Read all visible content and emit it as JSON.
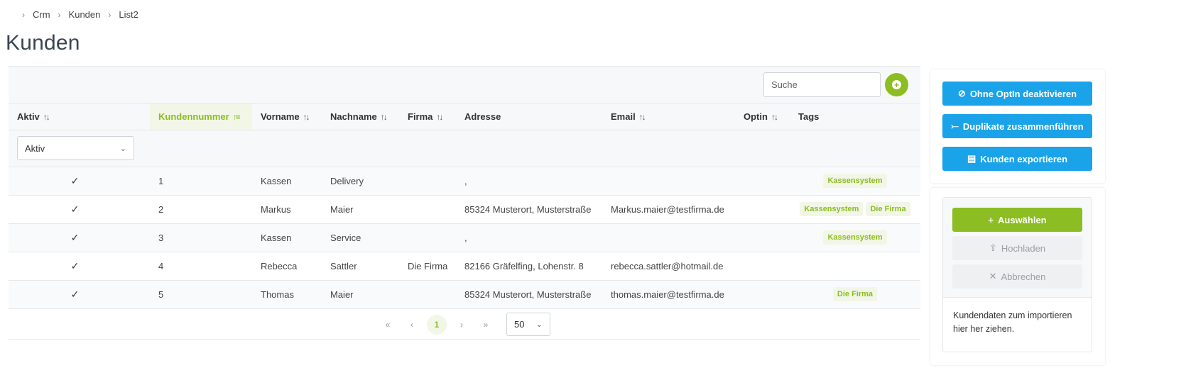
{
  "breadcrumb": [
    "Crm",
    "Kunden",
    "List2"
  ],
  "page": {
    "title": "Kunden"
  },
  "search": {
    "placeholder": "Suche"
  },
  "columns": [
    {
      "label": "Aktiv",
      "sortable": true
    },
    {
      "label": "Kundennummer",
      "sortable": true,
      "sorted": "asc"
    },
    {
      "label": "Vorname",
      "sortable": true
    },
    {
      "label": "Nachname",
      "sortable": true
    },
    {
      "label": "Firma",
      "sortable": true
    },
    {
      "label": "Adresse",
      "sortable": false
    },
    {
      "label": "Email",
      "sortable": true
    },
    {
      "label": "Optin",
      "sortable": true
    },
    {
      "label": "Tags",
      "sortable": false
    }
  ],
  "filter": {
    "aktiv_value": "Aktiv"
  },
  "rows": [
    {
      "aktiv": true,
      "kundennummer": "1",
      "vorname": "Kassen",
      "nachname": "Delivery",
      "firma": "",
      "adresse": ",",
      "email": "",
      "optin": "",
      "tags": [
        "Kassensystem"
      ]
    },
    {
      "aktiv": true,
      "kundennummer": "2",
      "vorname": "Markus",
      "nachname": "Maier",
      "firma": "",
      "adresse": "85324 Musterort, Musterstraße",
      "email": "Markus.maier@testfirma.de",
      "optin": "",
      "tags": [
        "Kassensystem",
        "Die Firma"
      ]
    },
    {
      "aktiv": true,
      "kundennummer": "3",
      "vorname": "Kassen",
      "nachname": "Service",
      "firma": "",
      "adresse": ",",
      "email": "",
      "optin": "",
      "tags": [
        "Kassensystem"
      ]
    },
    {
      "aktiv": true,
      "kundennummer": "4",
      "vorname": "Rebecca",
      "nachname": "Sattler",
      "firma": "Die Firma",
      "adresse": "82166 Gräfelfing, Lohenstr. 8",
      "email": "rebecca.sattler@hotmail.de",
      "optin": "",
      "tags": []
    },
    {
      "aktiv": true,
      "kundennummer": "5",
      "vorname": "Thomas",
      "nachname": "Maier",
      "firma": "",
      "adresse": "85324 Musterort, Musterstraße",
      "email": "thomas.maier@testfirma.de",
      "optin": "",
      "tags": [
        "Die Firma"
      ]
    }
  ],
  "pagination": {
    "current_page": "1",
    "page_size": "50"
  },
  "actions": {
    "deactivate_label": "Ohne OptIn deaktivieren",
    "merge_label": "Duplikate zusammenführen",
    "export_label": "Kunden exportieren"
  },
  "upload": {
    "select_label": "Auswählen",
    "upload_label": "Hochladen",
    "cancel_label": "Abbrechen",
    "drop_text": "Kundendaten zum importieren hier her ziehen."
  },
  "colors": {
    "accent_green": "#8cbd22",
    "action_blue": "#1aa3e8"
  }
}
